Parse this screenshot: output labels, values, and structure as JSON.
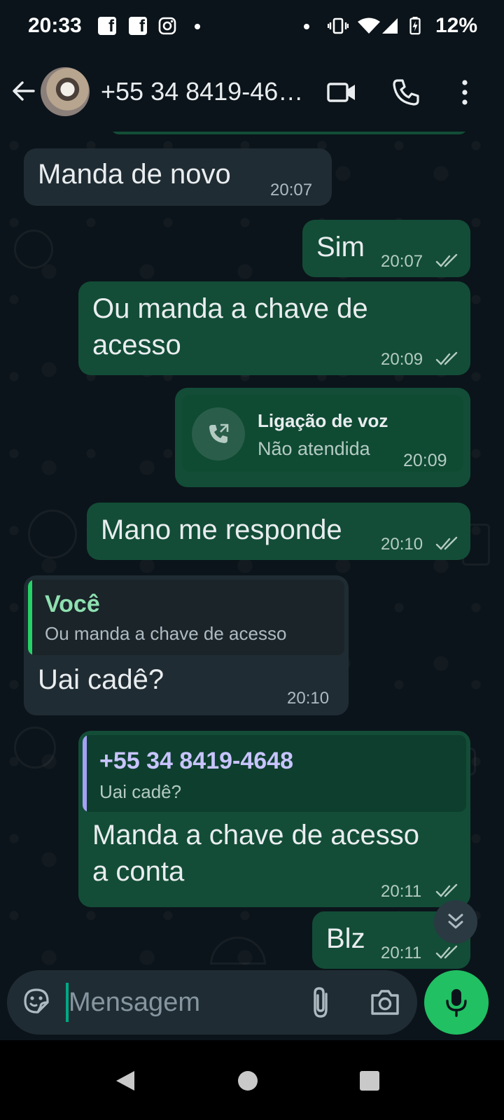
{
  "status_bar": {
    "time": "20:33",
    "battery": "12%",
    "icons": [
      "facebook-icon",
      "facebook-icon",
      "instagram-icon",
      "dot",
      "dot",
      "vibrate-icon",
      "wifi-icon",
      "signal-icon",
      "battery-charging-icon"
    ]
  },
  "header": {
    "contact_name": "+55 34 8419-46…",
    "icons": [
      "back-arrow-icon",
      "video-call-icon",
      "voice-call-icon",
      "more-options-icon"
    ]
  },
  "messages": [
    {
      "type": "text",
      "direction": "in",
      "text": "Manda de novo",
      "time": "20:07"
    },
    {
      "type": "text",
      "direction": "out",
      "text": "Sim",
      "time": "20:07",
      "status": "read"
    },
    {
      "type": "text",
      "direction": "out",
      "text_line1": "Ou manda a chave de",
      "text_line2": "acesso",
      "time": "20:09",
      "status": "read"
    },
    {
      "type": "call",
      "direction": "out",
      "title": "Ligação de voz",
      "subtitle": "Não atendida",
      "time": "20:09"
    },
    {
      "type": "text",
      "direction": "out",
      "text": "Mano me responde",
      "time": "20:10",
      "status": "read"
    },
    {
      "type": "reply",
      "direction": "in",
      "quote_author": "Você",
      "quote_text": "Ou manda a chave de acesso",
      "text": "Uai cadê?",
      "time": "20:10"
    },
    {
      "type": "reply",
      "direction": "out",
      "quote_author": "+55 34 8419-4648",
      "quote_text": "Uai cadê?",
      "text_line1": "Manda a chave de acesso",
      "text_line2": "a conta",
      "time": "20:11",
      "status": "read"
    },
    {
      "type": "text",
      "direction": "out",
      "text": "Blz",
      "time": "20:11",
      "status": "read"
    }
  ],
  "composer": {
    "placeholder": "Mensagem",
    "icons": [
      "sticker-icon",
      "attach-icon",
      "camera-icon",
      "mic-icon"
    ]
  },
  "colors": {
    "background": "#0b141a",
    "incoming_bubble": "#202c33",
    "outgoing_bubble": "#134d37",
    "accent_green": "#21c063",
    "quote_you": "#25d366",
    "quote_contact": "#a5a0f5"
  }
}
